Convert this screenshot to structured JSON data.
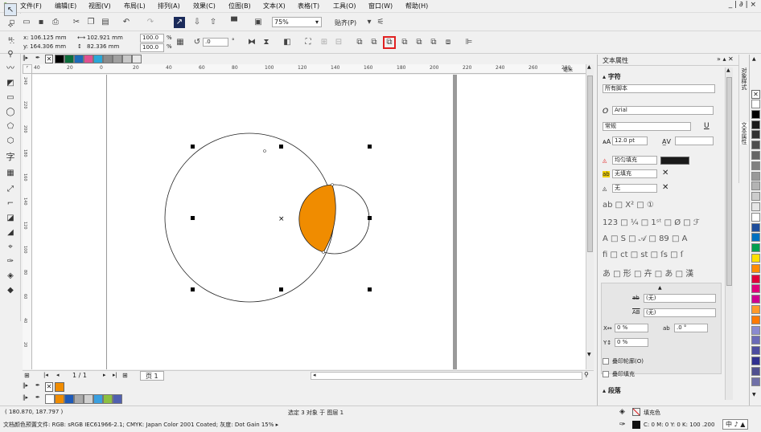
{
  "menubar": {
    "items": [
      "文件(F)",
      "编辑(E)",
      "视图(V)",
      "布局(L)",
      "排列(A)",
      "效果(C)",
      "位图(B)",
      "文本(X)",
      "表格(T)",
      "工具(O)",
      "窗口(W)",
      "帮助(H)"
    ],
    "window_controls": "_ | ∂ | ×"
  },
  "toolbar1": {
    "zoom": "75%",
    "snap": "贴齐(P)"
  },
  "toolbar2": {
    "x": "x: 106.125 mm",
    "y": "y: 164.306 mm",
    "w": "102.921 mm",
    "h": "82.336 mm",
    "scale_w": "100.0",
    "scale_h": "100.0",
    "pct": "%",
    "rotation": ".0",
    "deg": "°"
  },
  "ruler": {
    "unit": "毫米",
    "h_ticks": [
      "40",
      "20",
      "0",
      "20",
      "40",
      "60",
      "80",
      "100",
      "120",
      "140",
      "160",
      "180",
      "200",
      "220",
      "240",
      "260",
      "280"
    ],
    "v_ticks": [
      "240",
      "220",
      "200",
      "180",
      "160",
      "140",
      "120",
      "100",
      "80",
      "60",
      "40",
      "20"
    ]
  },
  "page_nav": {
    "counter": "1 / 1",
    "tab": "页 1"
  },
  "right_panel": {
    "title": "文本属性",
    "char_section": "字符",
    "script": "所有脚本",
    "font": "Arial",
    "style": "常规",
    "size": "12.0 pt",
    "fill_type": "均匀填充",
    "bg_fill": "无填充",
    "outline": "无",
    "none1": "(无)",
    "none2": "(无)",
    "spacing_x": "0 %",
    "spacing_ab": ".0 °",
    "spacing_y": "0 %",
    "chk_outline": "叠印轮廓(O)",
    "chk_fill": "叠印填充",
    "para_section": "段落",
    "vertical_tabs": [
      "对象样式",
      "文本属性"
    ]
  },
  "status": {
    "coords": "( 180.870, 187.797 )",
    "selection": "选定 3 对象 于 图层 1",
    "profile": "文档颜色预置文件: RGB: sRGB IEC61966-2.1; CMYK: Japan Color 2001 Coated; 灰度: Dot Gain 15% ▸",
    "fill_label": "填充色",
    "cmyk": "C: 0 M: 0 Y: 0 K: 100  .200",
    "ime": "中 ♪ ▲"
  },
  "colors": {
    "orange": "#f08c00",
    "accent_red": "#e02020"
  },
  "palette_colors": [
    "#ffffff",
    "#000000",
    "#1a1a1a",
    "#333333",
    "#4d4d4d",
    "#666666",
    "#808080",
    "#999999",
    "#b3b3b3",
    "#cccccc",
    "#e6e6e6",
    "#ffffff",
    "#1f4e9c",
    "#0070c0",
    "#00a050",
    "#ffe000",
    "#ff8c00",
    "#e0003c",
    "#e0007a",
    "#d00090",
    "#ff9a2a",
    "#ff7a00",
    "#8a8ad0",
    "#6a6ab8",
    "#4c4ca0",
    "#303090",
    "#505090",
    "#7070a8"
  ],
  "doc_palette": [
    "#000000",
    "#0b6e3c",
    "#1e6bb8",
    "#e05090",
    "#2aa8d8",
    "#8c8c8c",
    "#a0a0a0",
    "#c8c8c8",
    "#e8e8e8"
  ],
  "bottom_palette": [
    "#ffffff",
    "#f08c00",
    "#1e5ab8",
    "#aaaaaa",
    "#d0d0d0",
    "#3aa0e0",
    "#8dc040",
    "#5060b0"
  ]
}
